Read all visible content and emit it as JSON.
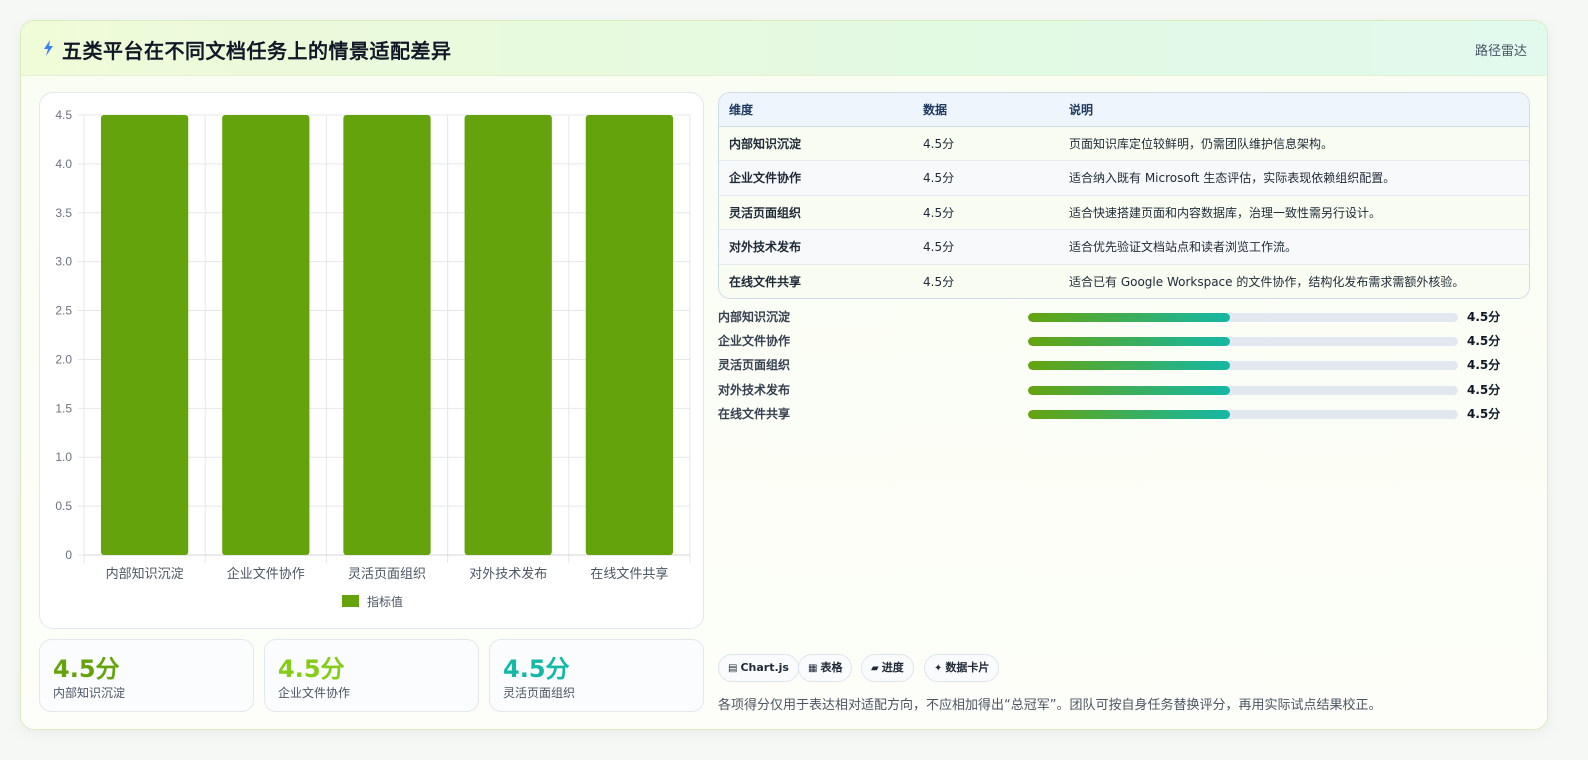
{
  "header": {
    "icon": "lightning-icon",
    "title": "五类平台在不同文档任务上的情景适配差异",
    "tag": "路径雷达"
  },
  "colors": {
    "bar": "#65a30d",
    "kpi": [
      "#65a30d",
      "#84cc16",
      "#14b8a6"
    ],
    "progress_start": "#65a30d",
    "progress_end": "#14b8a6"
  },
  "chart_data": {
    "type": "bar",
    "categories": [
      "内部知识沉淀",
      "企业文件协作",
      "灵活页面组织",
      "对外技术发布",
      "在线文件共享"
    ],
    "series": [
      {
        "name": "指标值",
        "values": [
          4.5,
          4.5,
          4.5,
          4.5,
          4.5
        ]
      }
    ],
    "ylim": [
      0,
      4.5
    ],
    "yticks": [
      "0",
      "0.5",
      "1.0",
      "1.5",
      "2.0",
      "2.5",
      "3.0",
      "3.5",
      "4.0",
      "4.5"
    ],
    "grid": true,
    "legend_position": "bottom"
  },
  "kpis": [
    {
      "value": "4.5分",
      "label": "内部知识沉淀"
    },
    {
      "value": "4.5分",
      "label": "企业文件协作"
    },
    {
      "value": "4.5分",
      "label": "灵活页面组织"
    }
  ],
  "table": {
    "headers": [
      "维度",
      "数据",
      "说明"
    ],
    "rows": [
      [
        "内部知识沉淀",
        "4.5分",
        "页面知识库定位较鲜明，仍需团队维护信息架构。"
      ],
      [
        "企业文件协作",
        "4.5分",
        "适合纳入既有 Microsoft 生态评估，实际表现依赖组织配置。"
      ],
      [
        "灵活页面组织",
        "4.5分",
        "适合快速搭建页面和内容数据库，治理一致性需另行设计。"
      ],
      [
        "对外技术发布",
        "4.5分",
        "适合优先验证文档站点和读者浏览工作流。"
      ],
      [
        "在线文件共享",
        "4.5分",
        "适合已有 Google Workspace 的文件协作，结构化发布需求需额外核验。"
      ]
    ]
  },
  "progress": [
    {
      "label": "内部知识沉淀",
      "value": "4.5分",
      "fraction": 0.47
    },
    {
      "label": "企业文件协作",
      "value": "4.5分",
      "fraction": 0.47
    },
    {
      "label": "灵活页面组织",
      "value": "4.5分",
      "fraction": 0.47
    },
    {
      "label": "对外技术发布",
      "value": "4.5分",
      "fraction": 0.47
    },
    {
      "label": "在线文件共享",
      "value": "4.5分",
      "fraction": 0.47
    }
  ],
  "chips": [
    {
      "icon": "chart-icon",
      "glyph": "▤",
      "label": "Chart.js"
    },
    {
      "icon": "table-icon",
      "glyph": "▦",
      "label": "表格"
    },
    {
      "icon": "progress-icon",
      "glyph": "▰",
      "label": "进度"
    },
    {
      "icon": "sparkle-icon",
      "glyph": "✦",
      "label": "数据卡片"
    }
  ],
  "note": "各项得分仅用于表达相对适配方向，不应相加得出“总冠军”。团队可按自身任务替换评分，再用实际试点结果校正。"
}
